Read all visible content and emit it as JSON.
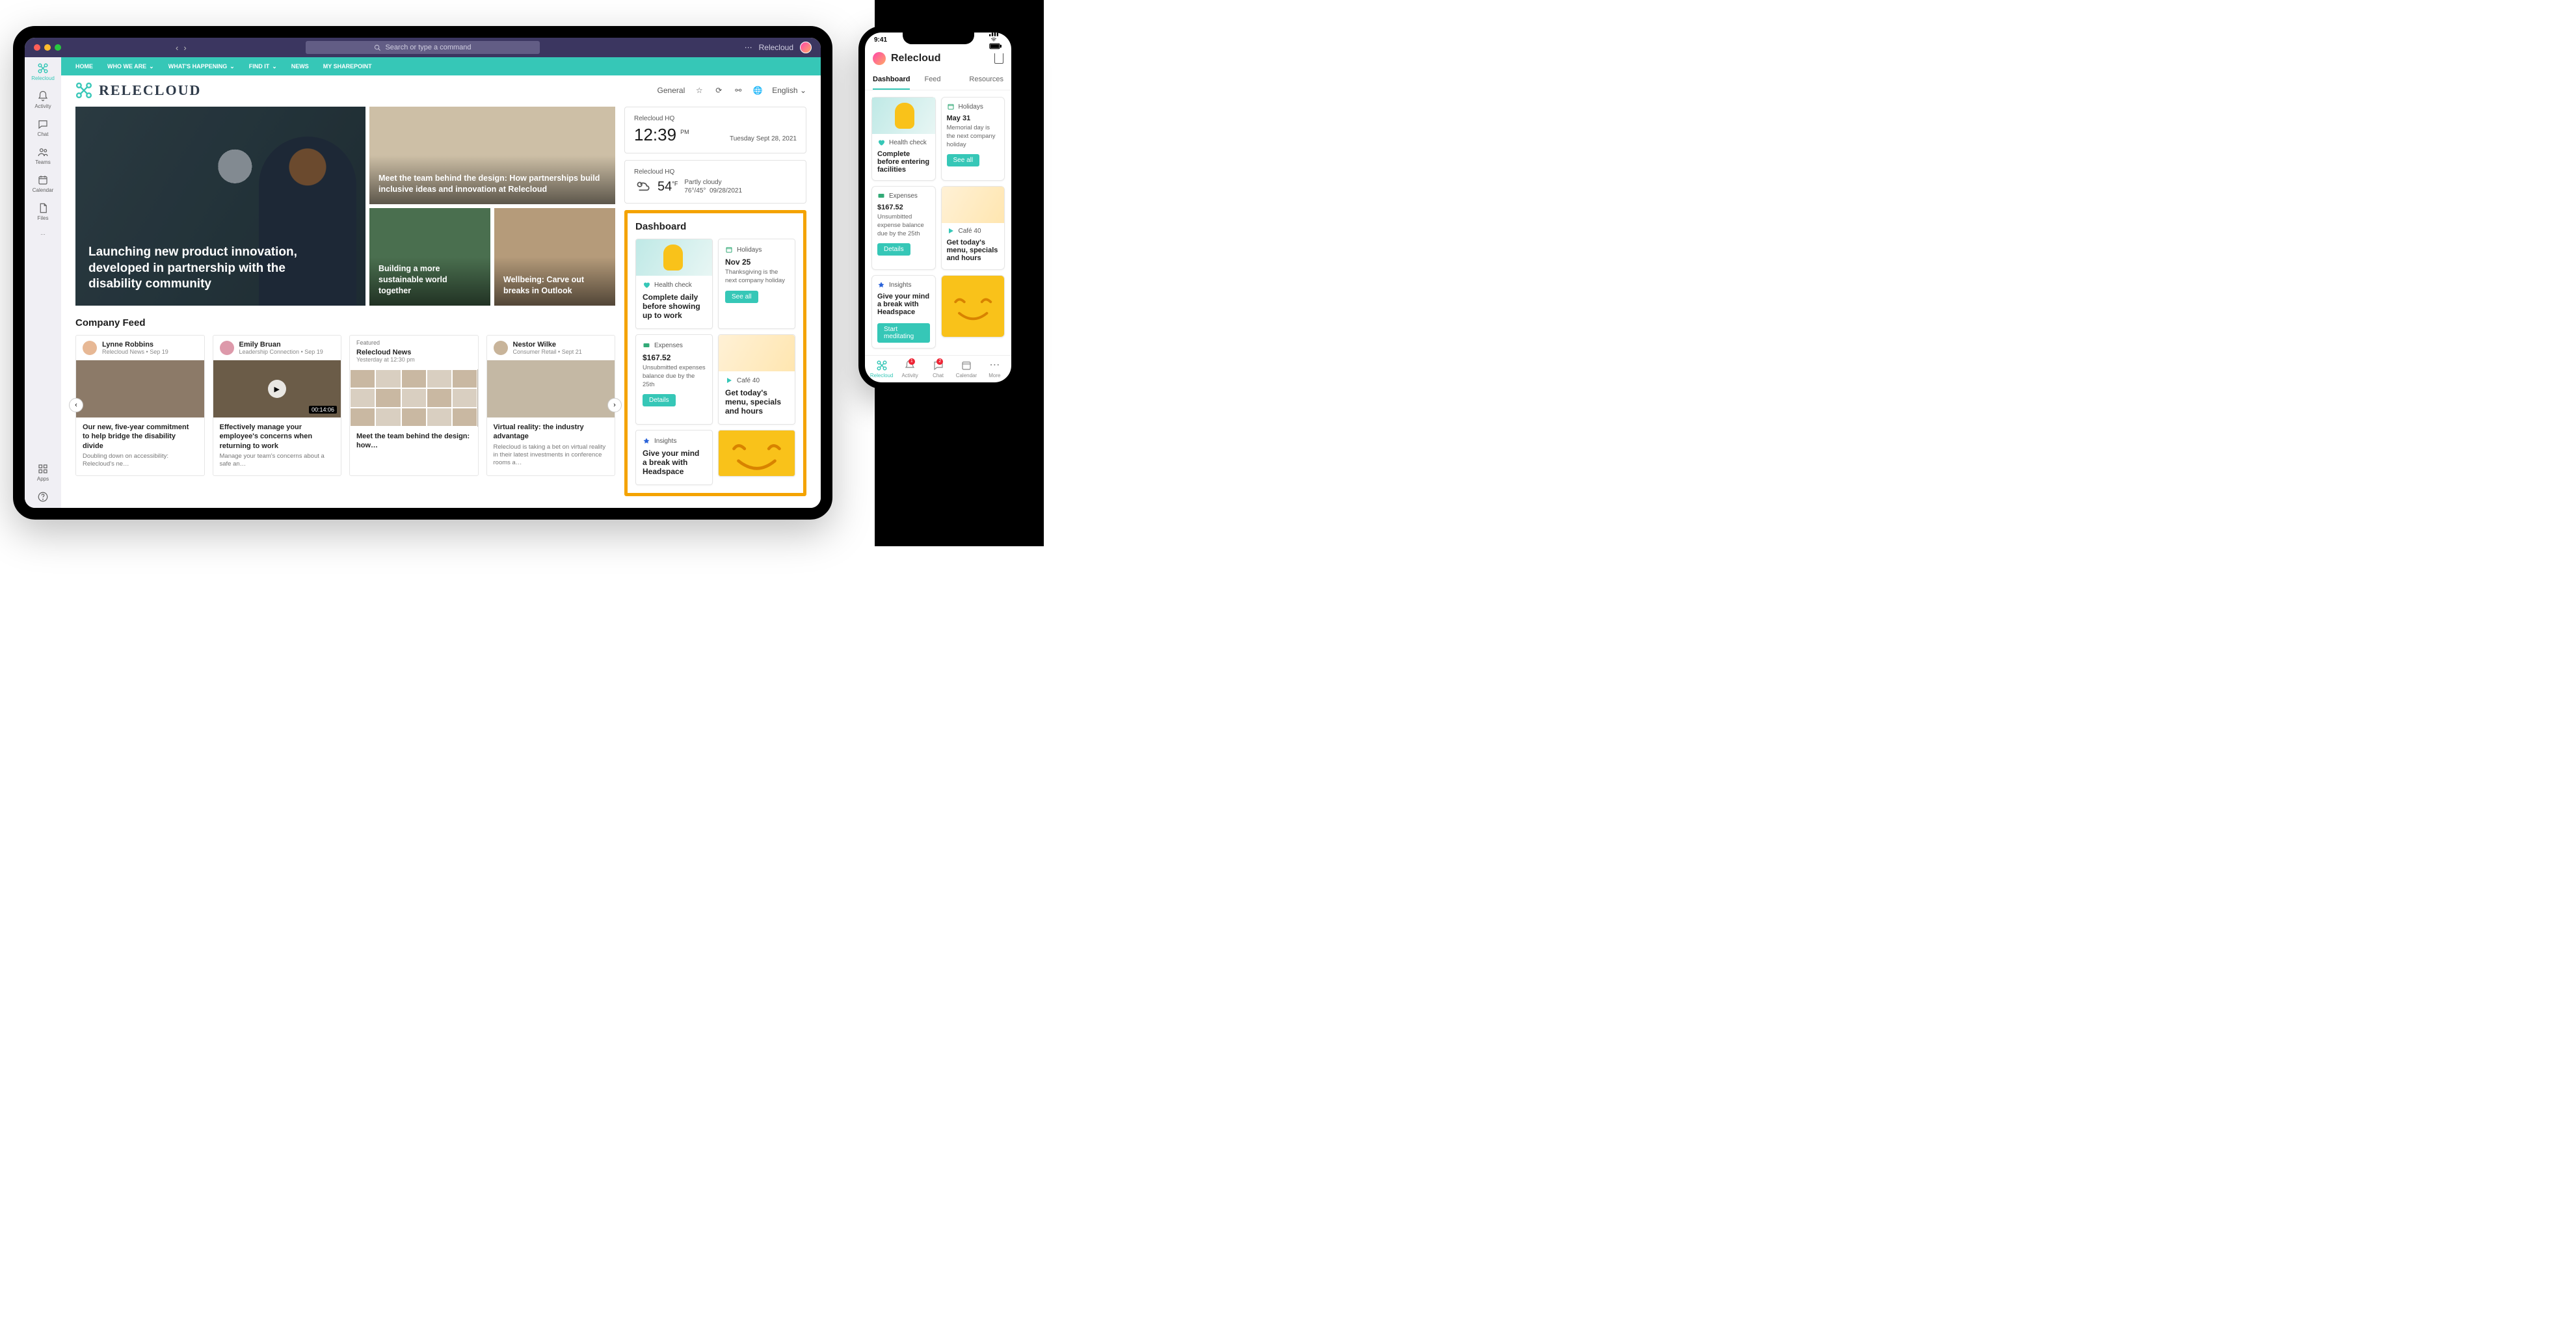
{
  "titlebar": {
    "search_placeholder": "Search or type a command",
    "tenant": "Relecloud"
  },
  "rail": [
    {
      "key": "relecloud",
      "label": "Relecloud"
    },
    {
      "key": "activity",
      "label": "Activity"
    },
    {
      "key": "chat",
      "label": "Chat"
    },
    {
      "key": "teams",
      "label": "Teams"
    },
    {
      "key": "calendar",
      "label": "Calendar"
    },
    {
      "key": "files",
      "label": "Files"
    },
    {
      "key": "more",
      "label": "…"
    }
  ],
  "rail_bottom": [
    {
      "key": "apps",
      "label": "Apps"
    },
    {
      "key": "help",
      "label": ""
    }
  ],
  "topnav": [
    {
      "label": "HOME"
    },
    {
      "label": "WHO WE ARE",
      "caret": true
    },
    {
      "label": "WHAT'S HAPPENING",
      "caret": true
    },
    {
      "label": "FIND IT",
      "caret": true
    },
    {
      "label": "NEWS"
    },
    {
      "label": "MY SHAREPOINT"
    }
  ],
  "brand": {
    "name": "RELECLOUD",
    "general": "General",
    "language": "English"
  },
  "hero": {
    "a": "Launching new product innovation, developed in partnership with the disability community",
    "b": "Meet the team behind the design: How partnerships build inclusive ideas and innovation at Relecloud",
    "c": "Building a more sustainable world together",
    "d": "Wellbeing: Carve out breaks in Outlook"
  },
  "feed": {
    "title": "Company Feed",
    "items": [
      {
        "author": "Lynne Robbins",
        "source": "Relecloud News",
        "date": "Sep 19",
        "headline": "Our new, five-year commitment to help bridge the disability divide",
        "desc": "Doubling down on accessibility: Relecloud's ne…"
      },
      {
        "author": "Emily Bruan",
        "source": "Leadership Connection",
        "date": "Sep 19",
        "duration": "00:14:06",
        "headline": "Effectively manage your employee's concerns when returning to work",
        "desc": "Manage your team's concerns about a safe an…"
      },
      {
        "featured": "Featured",
        "author": "Relecloud News",
        "meta": "Yesterday at 12:30 pm",
        "headline": "Meet the team behind the design: how…"
      },
      {
        "author": "Nestor Wilke",
        "source": "Consumer Retail",
        "date": "Sept 21",
        "headline": "Virtual reality: the industry advantage",
        "desc": "Relecloud is taking a bet on virtual reality in their latest investments in conference rooms a…"
      }
    ]
  },
  "widgets": {
    "clock": {
      "location": "Relecloud HQ",
      "time": "12:39",
      "ampm": "PM",
      "date": "Tuesday Sept 28, 2021"
    },
    "weather": {
      "location": "Relecloud HQ",
      "temp": "54",
      "unit": "°F",
      "cond": "Partly cloudy",
      "range": "76°/45°",
      "date": "09/28/2021"
    }
  },
  "dashboard": {
    "title": "Dashboard",
    "health": {
      "label": "Health check",
      "text": "Complete daily before showing up to work"
    },
    "holidays": {
      "label": "Holidays",
      "title": "Nov 25",
      "text": "Thanksgiving is the next company holiday",
      "cta": "See all"
    },
    "expenses": {
      "label": "Expenses",
      "title": "$167.52",
      "text": "Unsubmitted expenses balance due by the 25th",
      "cta": "Details"
    },
    "cafe": {
      "label": "Café 40",
      "text": "Get today's menu, specials and hours"
    },
    "insights": {
      "label": "Insights",
      "text": "Give your mind a break with Headspace"
    }
  },
  "phone": {
    "time": "9:41",
    "title": "Relecloud",
    "tabs": [
      "Dashboard",
      "Feed",
      "Resources"
    ],
    "holidays": {
      "label": "Holidays",
      "title": "May 31",
      "text": "Memorial day is the next company holiday",
      "cta": "See all"
    },
    "health": {
      "label": "Health check",
      "text": "Complete before entering facilities"
    },
    "expenses": {
      "label": "Expenses",
      "title": "$167.52",
      "text": "Unsumbitted expense balance due by the 25th",
      "cta": "Details"
    },
    "cafe": {
      "label": "Café 40",
      "text": "Get today's menu, specials and hours"
    },
    "insights": {
      "label": "Insights",
      "text": "Give your mind a break with Headspace",
      "cta": "Start meditating"
    },
    "nav": [
      "Relecloud",
      "Activity",
      "Chat",
      "Calendar",
      "More"
    ]
  }
}
